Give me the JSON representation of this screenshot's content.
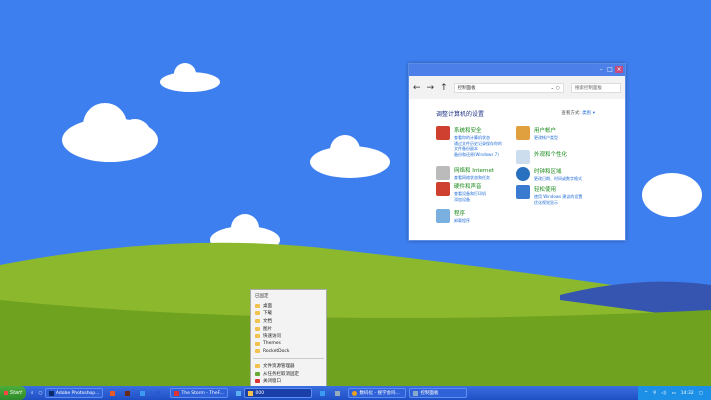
{
  "window": {
    "address": "控制面板",
    "search_placeholder": "搜索控制面板",
    "title": "调整计算机的设置",
    "view_label": "查看方式:",
    "view_value": "类别 ▾",
    "categories": [
      {
        "name": "系统和安全",
        "links": [
          "查看你的计算机状态",
          "通过文件历史记录保存你的",
          "文件备份副本",
          "备份和还原(Windows 7)"
        ],
        "icon": "shield-icon"
      },
      {
        "name": "网络和 Internet",
        "links": [
          "查看网络状态和任务"
        ],
        "icon": "network-icon"
      },
      {
        "name": "硬件和声音",
        "links": [
          "查看设备和打印机",
          "添加设备"
        ],
        "icon": "shield-icon"
      },
      {
        "name": "程序",
        "links": [
          "卸载程序"
        ],
        "icon": "programs-icon"
      },
      {
        "name": "用户帐户",
        "links": [
          "更改帐户类型"
        ],
        "icon": "users-icon"
      },
      {
        "name": "外观和个性化",
        "links": [],
        "icon": "appearance-icon"
      },
      {
        "name": "时钟和区域",
        "links": [
          "更改日期、时间或数字格式"
        ],
        "icon": "globe-icon"
      },
      {
        "name": "轻松使用",
        "links": [
          "使用 Windows 建议的设置",
          "优化视觉显示"
        ],
        "icon": "ease-icon"
      }
    ]
  },
  "jumplist": {
    "header": "已固定",
    "items": [
      "桌面",
      "下载",
      "文档",
      "图片",
      "快速访问",
      "Themes",
      "RocketDock"
    ],
    "actions": [
      "文件资源管理器",
      "从任务栏取消固定",
      "关闭窗口"
    ]
  },
  "taskbar": {
    "start": "Start",
    "buttons": [
      "Adobe Photoshop...",
      "The Storm - TheF...",
      "000",
      "数码化 - 搜学会吗...",
      "控制面板"
    ],
    "time": "14:32"
  }
}
